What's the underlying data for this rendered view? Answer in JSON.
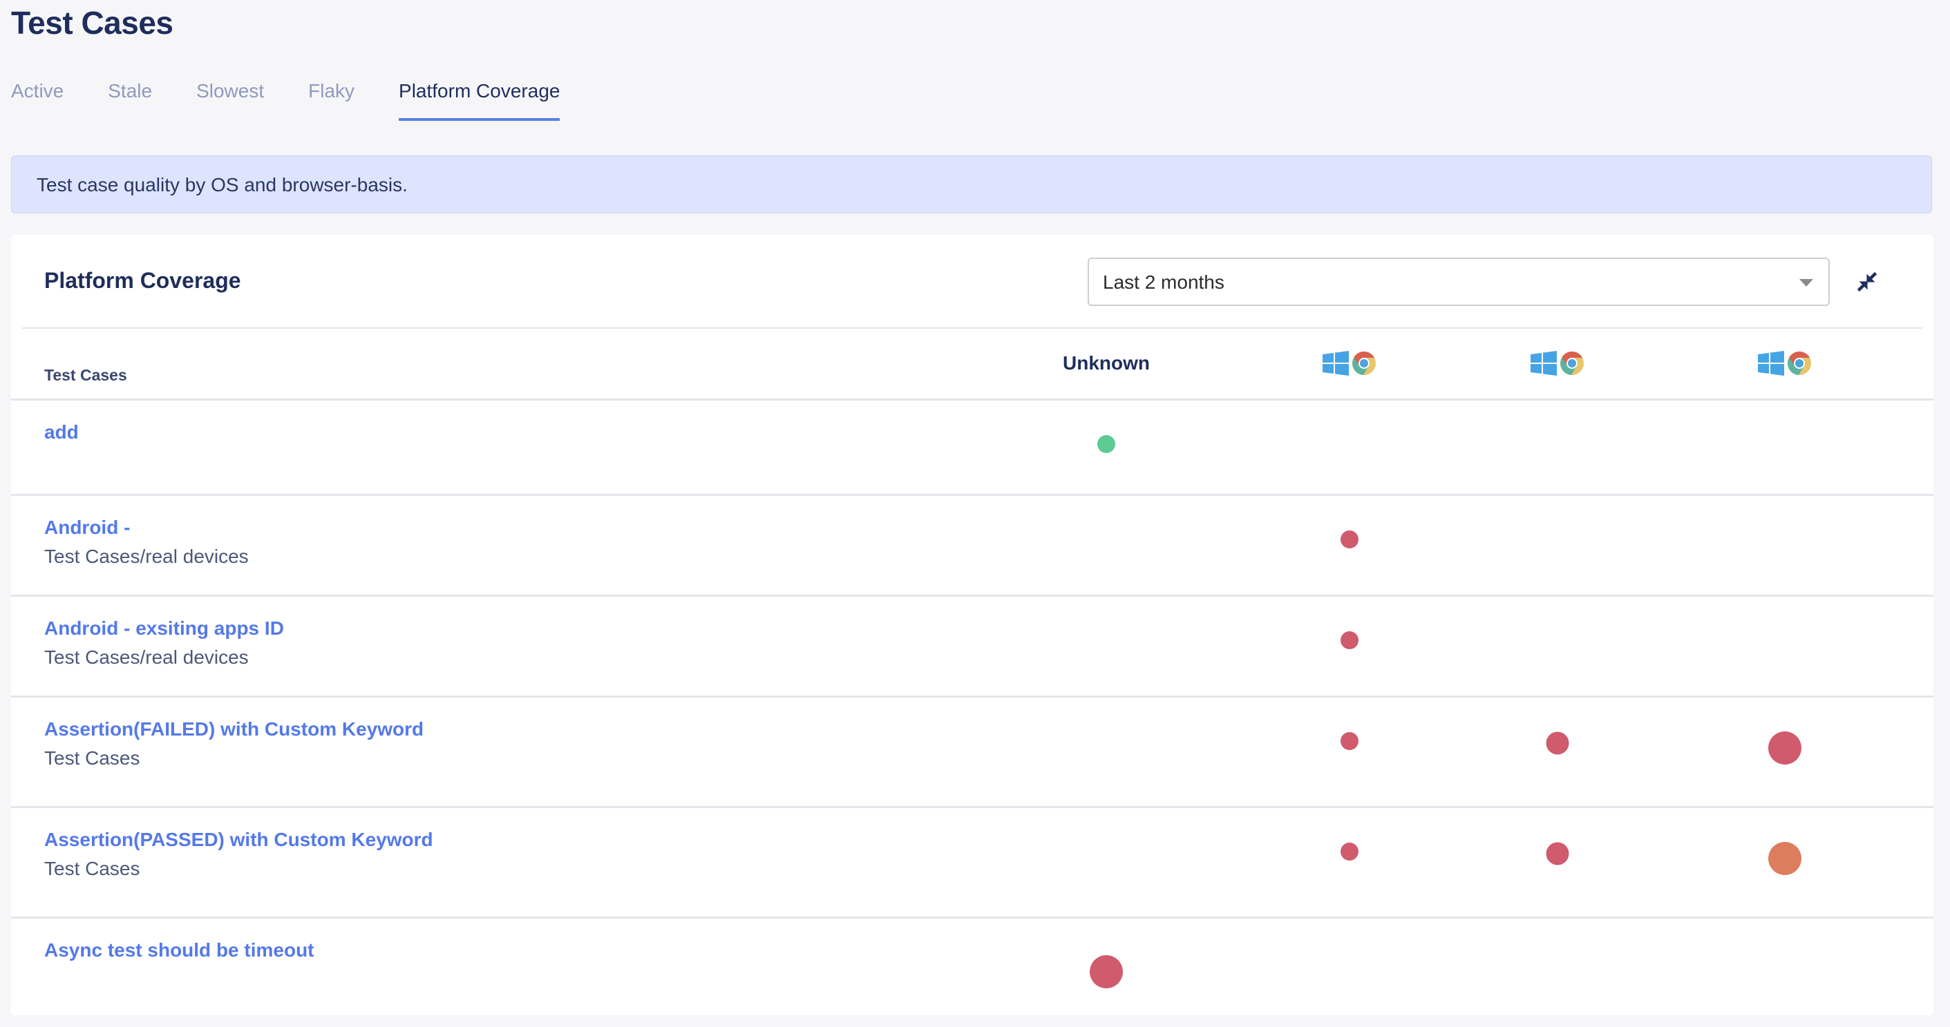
{
  "page": {
    "title": "Test Cases"
  },
  "tabs": [
    {
      "label": "Active",
      "active": false
    },
    {
      "label": "Stale",
      "active": false
    },
    {
      "label": "Slowest",
      "active": false
    },
    {
      "label": "Flaky",
      "active": false
    },
    {
      "label": "Platform Coverage",
      "active": true
    }
  ],
  "banner": {
    "text": "Test case quality by OS and browser-basis."
  },
  "card": {
    "title": "Platform Coverage",
    "time_range": {
      "selected": "Last 2 months"
    },
    "collapse_icon": "collapse-arrows-icon"
  },
  "table": {
    "first_column_header": "Test Cases",
    "columns": [
      {
        "type": "text",
        "label": "Unknown"
      },
      {
        "type": "platform",
        "os_icon": "windows-icon",
        "browser_icon": "chrome-icon"
      },
      {
        "type": "platform",
        "os_icon": "windows-icon",
        "browser_icon": "chrome-icon"
      },
      {
        "type": "platform",
        "os_icon": "windows-icon",
        "browser_icon": "chrome-icon"
      }
    ],
    "status_colors": {
      "passed": "#5dcb93",
      "failed": "#cf5b6c",
      "mixed": "#dc7d5d"
    },
    "rows": [
      {
        "name": "add",
        "path": "",
        "cells": [
          {
            "col": 0,
            "status": "passed",
            "size": "small"
          }
        ]
      },
      {
        "name": "Android -",
        "path": "Test Cases/real devices",
        "cells": [
          {
            "col": 1,
            "status": "failed",
            "size": "small"
          }
        ]
      },
      {
        "name": "Android - exsiting apps ID",
        "path": "Test Cases/real devices",
        "cells": [
          {
            "col": 1,
            "status": "failed",
            "size": "small"
          }
        ]
      },
      {
        "name": "Assertion(FAILED) with Custom Keyword",
        "path": "Test Cases",
        "cells": [
          {
            "col": 1,
            "status": "failed",
            "size": "small"
          },
          {
            "col": 2,
            "status": "failed",
            "size": "medium"
          },
          {
            "col": 3,
            "status": "failed",
            "size": "large"
          }
        ]
      },
      {
        "name": "Assertion(PASSED) with Custom Keyword",
        "path": "Test Cases",
        "cells": [
          {
            "col": 1,
            "status": "failed",
            "size": "small"
          },
          {
            "col": 2,
            "status": "failed",
            "size": "medium"
          },
          {
            "col": 3,
            "status": "mixed",
            "size": "large"
          }
        ]
      },
      {
        "name": "Async test should be timeout",
        "path": "",
        "cells": [
          {
            "col": 0,
            "status": "failed",
            "size": "large"
          }
        ]
      }
    ]
  }
}
